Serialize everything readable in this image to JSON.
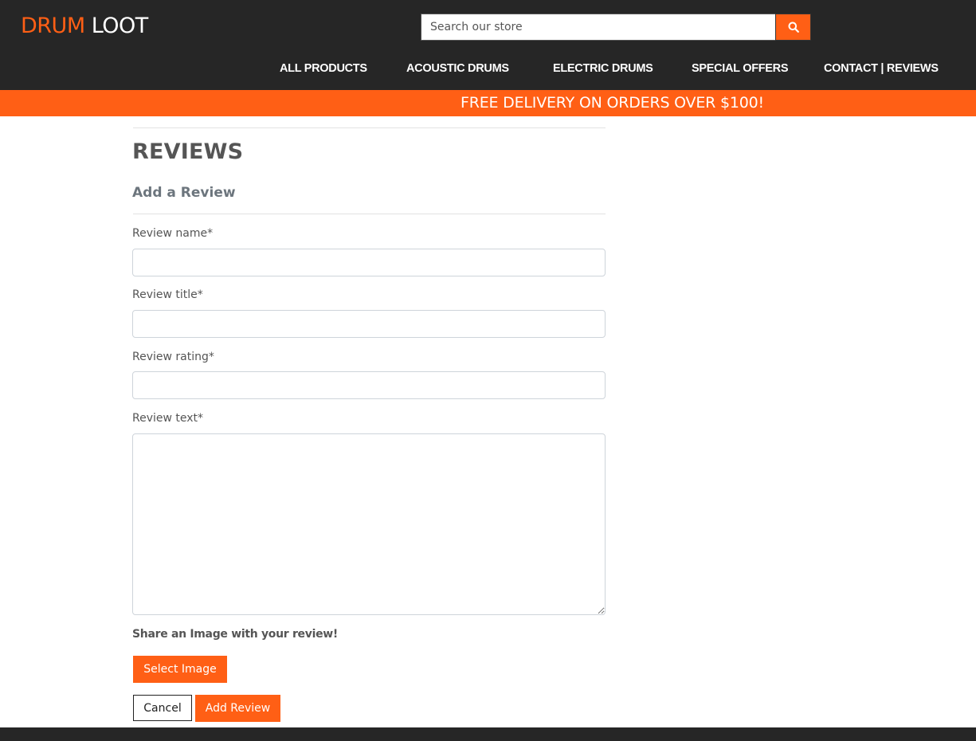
{
  "brand": {
    "part1": "DRUM",
    "part2": "LOOT"
  },
  "search": {
    "placeholder": "Search our store",
    "button_icon": "search-icon"
  },
  "nav": {
    "items": [
      {
        "label": "ALL PRODUCTS"
      },
      {
        "label": "ACOUSTIC DRUMS"
      },
      {
        "label": "ELECTRIC DRUMS"
      },
      {
        "label": "SPECIAL OFFERS"
      },
      {
        "label": "CONTACT | REVIEWS"
      }
    ]
  },
  "banner": {
    "text": "FREE DELIVERY ON ORDERS OVER $100!"
  },
  "reviews": {
    "title": "REVIEWS",
    "subtitle": "Add a Review",
    "fields": {
      "name_label": "Review name*",
      "title_label": "Review title*",
      "rating_label": "Review rating*",
      "text_label": "Review text*"
    },
    "share_label": "Share an Image with your review!",
    "select_image_label": "Select Image",
    "cancel_label": "Cancel",
    "add_review_label": "Add Review"
  },
  "colors": {
    "accent": "#ff5f15",
    "header_bg": "#262626"
  }
}
